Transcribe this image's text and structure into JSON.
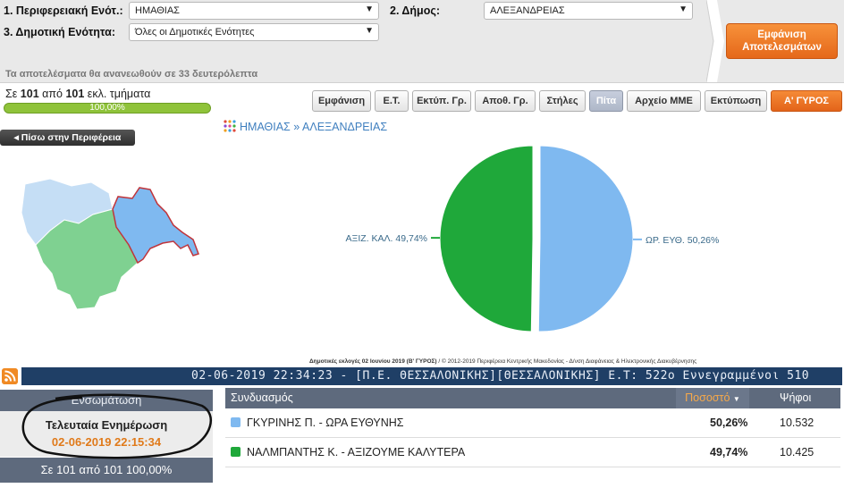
{
  "filters": {
    "region_label": "1. Περιφερειακή Ενότ.:",
    "region_value": "ΗΜΑΘΙΑΣ",
    "municipality_label": "2. Δήμος:",
    "municipality_value": "ΑΛΕΞΑΝΔΡΕΙΑΣ",
    "unit_label": "3. Δημοτική Ενότητα:",
    "unit_value": "Όλες οι Δημοτικές Ενότητες",
    "refresh_notice": "Τα αποτελέσματα θα ανανεωθούν σε 33 δευτερόλεπτα",
    "show_results_label": "Εμφάνιση Αποτελεσμάτων"
  },
  "progress": {
    "prefix": "Σε",
    "counted": "101",
    "middle": "από",
    "total": "101",
    "suffix": "εκλ. τμήματα",
    "percent_label": "100,00%",
    "fraction": 1.0
  },
  "toolbar": {
    "buttons": [
      "Εμφάνιση",
      "Ε.Τ.",
      "Εκτύπ. Γρ.",
      "Αποθ. Γρ.",
      "Στήλες",
      "Πίτα",
      "Αρχείο ΜΜΕ",
      "Εκτύπωση",
      "Α' ΓΥΡΟΣ"
    ],
    "active": "Πίτα"
  },
  "nav": {
    "back_label": "◂ Πίσω στην Περιφέρεια",
    "breadcrumb_region": "ΗΜΑΘΙΑΣ",
    "breadcrumb_sep": "»",
    "breadcrumb_municipality": "ΑΛΕΞΑΝΔΡΕΙΑΣ"
  },
  "chart_data": {
    "type": "pie",
    "slices": [
      {
        "label": "ΩΡ. ΕΥΘ. 50,26%",
        "value": 50.26,
        "color": "#7fb9f0"
      },
      {
        "label": "ΑΞΙΖ. ΚΑΛ. 49,74%",
        "value": 49.74,
        "color": "#1fa83a"
      }
    ]
  },
  "credit": {
    "bold": "Δημοτικές εκλογές 02 Ιουνίου 2019 (Β' ΓΥΡΟΣ)",
    "rest": " / © 2012-2019 Περιφέρεια Κεντρικής Μακεδονίας - Δ/νση Διαφάνειας & Ηλεκτρονικής Διακυβέρνησης"
  },
  "ticker": {
    "text": "02-06-2019 22:34:23 - [Π.Ε. ΘΕΣΣΑΛΟΝΙΚΗΣ][ΘΕΣΣΑΛΟΝΙΚΗΣ] Ε.Τ: 522ο  Εννεγραμμένοι 510"
  },
  "status": {
    "header": "Ενσωμάτωση",
    "last_update_label": "Τελευταία Ενημέρωση",
    "last_update_value": "02-06-2019 22:15:34",
    "footer": "Σε 101 από 101 100,00%"
  },
  "results": {
    "col_combination": "Συνδυασμός",
    "col_percent": "Ποσοστό",
    "col_votes": "Ψήφοι",
    "rows": [
      {
        "name": "ΓΚΥΡΙΝΗΣ Π. - ΩΡΑ ΕΥΘΥΝΗΣ",
        "percent": "50,26%",
        "votes": "10.532",
        "color": "#7fb9f0"
      },
      {
        "name": "ΝΑΛΜΠΑΝΤΗΣ Κ. - ΑΞΙΖΟΥΜΕ ΚΑΛΥΤΕΡΑ",
        "percent": "49,74%",
        "votes": "10.425",
        "color": "#1fa83a"
      }
    ]
  },
  "colors": {
    "accent_orange": "#e5681a",
    "header_slate": "#5e6a7d",
    "ticker_navy": "#1f3f66",
    "progress_green": "#8fc33a"
  }
}
